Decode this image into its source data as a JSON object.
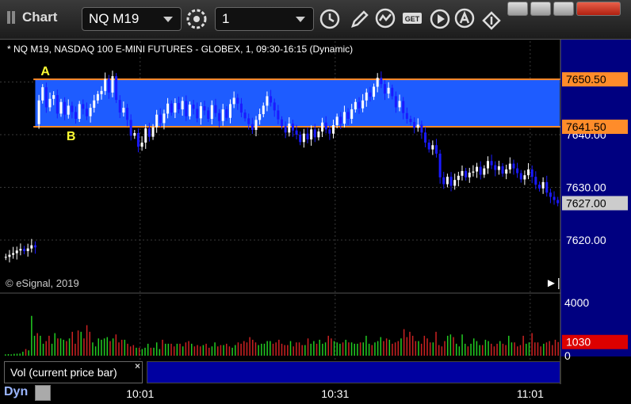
{
  "titlebar": {
    "title": "Chart",
    "symbol": "NQ M19",
    "interval": "1",
    "icons": [
      "gear-icon",
      "clock-icon",
      "pencil-icon",
      "study-icon",
      "get-icon",
      "play-icon",
      "alert-icon",
      "link-icon"
    ],
    "window_buttons": [
      "minimize-icon",
      "restore-icon",
      "maximize-icon",
      "close-icon"
    ]
  },
  "header_text": "* NQ M19, NASDAQ 100 E-MINI FUTURES - GLOBEX, 1, 09:30-16:15 (Dynamic)",
  "copyright": "© eSignal, 2019",
  "volume_panel": {
    "label": "Vol (current price bar)",
    "close": "×"
  },
  "footer": {
    "dyn_label": "Dyn"
  },
  "colors": {
    "up": "#ffffff",
    "down": "#1a1aff",
    "band": "#1e5cff",
    "level_line": "#ff8c2a",
    "vol_up": "#22cc22",
    "vol_down": "#cc2222",
    "axis_bg": "#000080",
    "last_tag": "#cccccc",
    "vol_tag": "#dd0000"
  },
  "chart_data": {
    "type": "candlestick",
    "price_axis": {
      "range": [
        7615,
        7658
      ],
      "tick_labels": [
        "7620.00",
        "7630.00",
        "7640.00"
      ],
      "grid": true
    },
    "time_axis": {
      "tick_labels": [
        "10:01",
        "10:31",
        "11:01"
      ]
    },
    "annotations": [
      {
        "text": "A",
        "price": 7650.5,
        "at_bar": 10
      },
      {
        "text": "B",
        "price": 7641.5,
        "at_bar": 17
      }
    ],
    "levels": [
      {
        "label": "7650.50",
        "price": 7650.5
      },
      {
        "label": "7641.50",
        "price": 7641.5
      }
    ],
    "last_price_label": "7627.00",
    "last_price": 7627.0,
    "volume": {
      "range": [
        0,
        4000
      ],
      "tick_labels": [
        "4000",
        "0"
      ],
      "last_label": "1030",
      "last_value": 1030,
      "values": [
        100,
        120,
        100,
        140,
        150,
        160,
        300,
        500,
        400,
        3000,
        1500,
        1700,
        1500,
        900,
        1100,
        1500,
        900,
        1700,
        1300,
        1300,
        1200,
        1100,
        1300,
        1800,
        900,
        1900,
        1800,
        1300,
        2300,
        1800,
        1000,
        700,
        1300,
        1200,
        1300,
        1400,
        1100,
        1300,
        1600,
        1000,
        1200,
        1200,
        900,
        700,
        800,
        600,
        600,
        500,
        600,
        900,
        600,
        600,
        1000,
        500,
        1200,
        900,
        900,
        900,
        700,
        900,
        900,
        700,
        1000,
        1100,
        900,
        700,
        800,
        700,
        800,
        900,
        600,
        700,
        1000,
        700,
        800,
        800,
        900,
        700,
        600,
        800,
        1000,
        900,
        1100,
        1000,
        1400,
        1200,
        1000,
        800,
        900,
        900,
        1100,
        1100,
        900,
        1000,
        1200,
        900,
        800,
        800,
        1100,
        700,
        1000,
        1000,
        800,
        800,
        1300,
        900,
        1100,
        900,
        1200,
        900,
        1000,
        1500,
        1300,
        1100,
        1000,
        900,
        1000,
        1200,
        1000,
        1000,
        900,
        900,
        1000,
        1000,
        1500,
        900,
        800,
        1000,
        1100,
        1400,
        1100,
        1300,
        1200,
        900,
        1000,
        1100,
        1300,
        2000,
        1400,
        1800,
        1500,
        1100,
        1100,
        900,
        1500,
        1300,
        1000,
        1000,
        1800,
        800,
        700,
        1100,
        1500,
        1600,
        1400,
        900,
        700,
        1600,
        900,
        700,
        900,
        1300,
        1100,
        800,
        800,
        1200,
        1100,
        900,
        700,
        900,
        1100,
        900,
        800,
        1500,
        1000,
        1000,
        700,
        800,
        1500,
        900,
        1000,
        1700,
        1000,
        1000,
        700,
        900,
        1000,
        1100,
        800,
        1200,
        1030
      ]
    },
    "closes": [
      7616.8,
      7617.2,
      7617.5,
      7618.0,
      7618.3,
      7617.9,
      7618.4,
      7619.0,
      7618.6,
      7646.5,
      7649.0,
      7645.2,
      7646.8,
      7647.5,
      7644.0,
      7646.2,
      7643.8,
      7645.5,
      7644.3,
      7643.0,
      7645.8,
      7644.9,
      7643.5,
      7645.1,
      7646.5,
      7647.7,
      7648.3,
      7650.6,
      7648.0,
      7651.1,
      7646.6,
      7644.2,
      7645.1,
      7642.8,
      7639.8,
      7640.3,
      7637.7,
      7638.5,
      7641.2,
      7639.6,
      7641.4,
      7643.8,
      7642.2,
      7644.0,
      7645.9,
      7644.2,
      7646.0,
      7644.8,
      7646.4,
      7643.5,
      7645.7,
      7644.9,
      7643.1,
      7645.4,
      7644.6,
      7643.0,
      7645.6,
      7644.1,
      7642.6,
      7644.8,
      7643.2,
      7645.8,
      7647.0,
      7645.9,
      7644.2,
      7643.1,
      7642.0,
      7640.9,
      7642.8,
      7643.9,
      7645.5,
      7647.3,
      7646.1,
      7644.6,
      7642.9,
      7641.6,
      7640.4,
      7642.1,
      7640.8,
      7640.0,
      7638.6,
      7640.2,
      7639.1,
      7641.0,
      7639.5,
      7640.6,
      7642.3,
      7641.0,
      7640.2,
      7641.8,
      7643.4,
      7642.1,
      7644.3,
      7643.0,
      7644.8,
      7646.2,
      7645.0,
      7646.5,
      7648.0,
      7647.2,
      7649.1,
      7650.8,
      7649.6,
      7647.8,
      7648.9,
      7647.3,
      7645.2,
      7646.4,
      7644.1,
      7643.0,
      7642.4,
      7641.3,
      7641.9,
      7640.4,
      7638.5,
      7637.2,
      7638.0,
      7636.4,
      7631.9,
      7630.6,
      7632.0,
      7630.3,
      7631.4,
      7632.2,
      7633.1,
      7631.9,
      7632.8,
      7633.0,
      7633.9,
      7632.4,
      7633.6,
      7635.0,
      7634.2,
      7633.3,
      7634.0,
      7632.6,
      7633.4,
      7634.5,
      7633.6,
      7632.7,
      7631.5,
      7632.3,
      7633.4,
      7632.0,
      7630.5,
      7629.8,
      7631.0,
      7629.0,
      7628.2,
      7627.6,
      7627.0
    ]
  }
}
